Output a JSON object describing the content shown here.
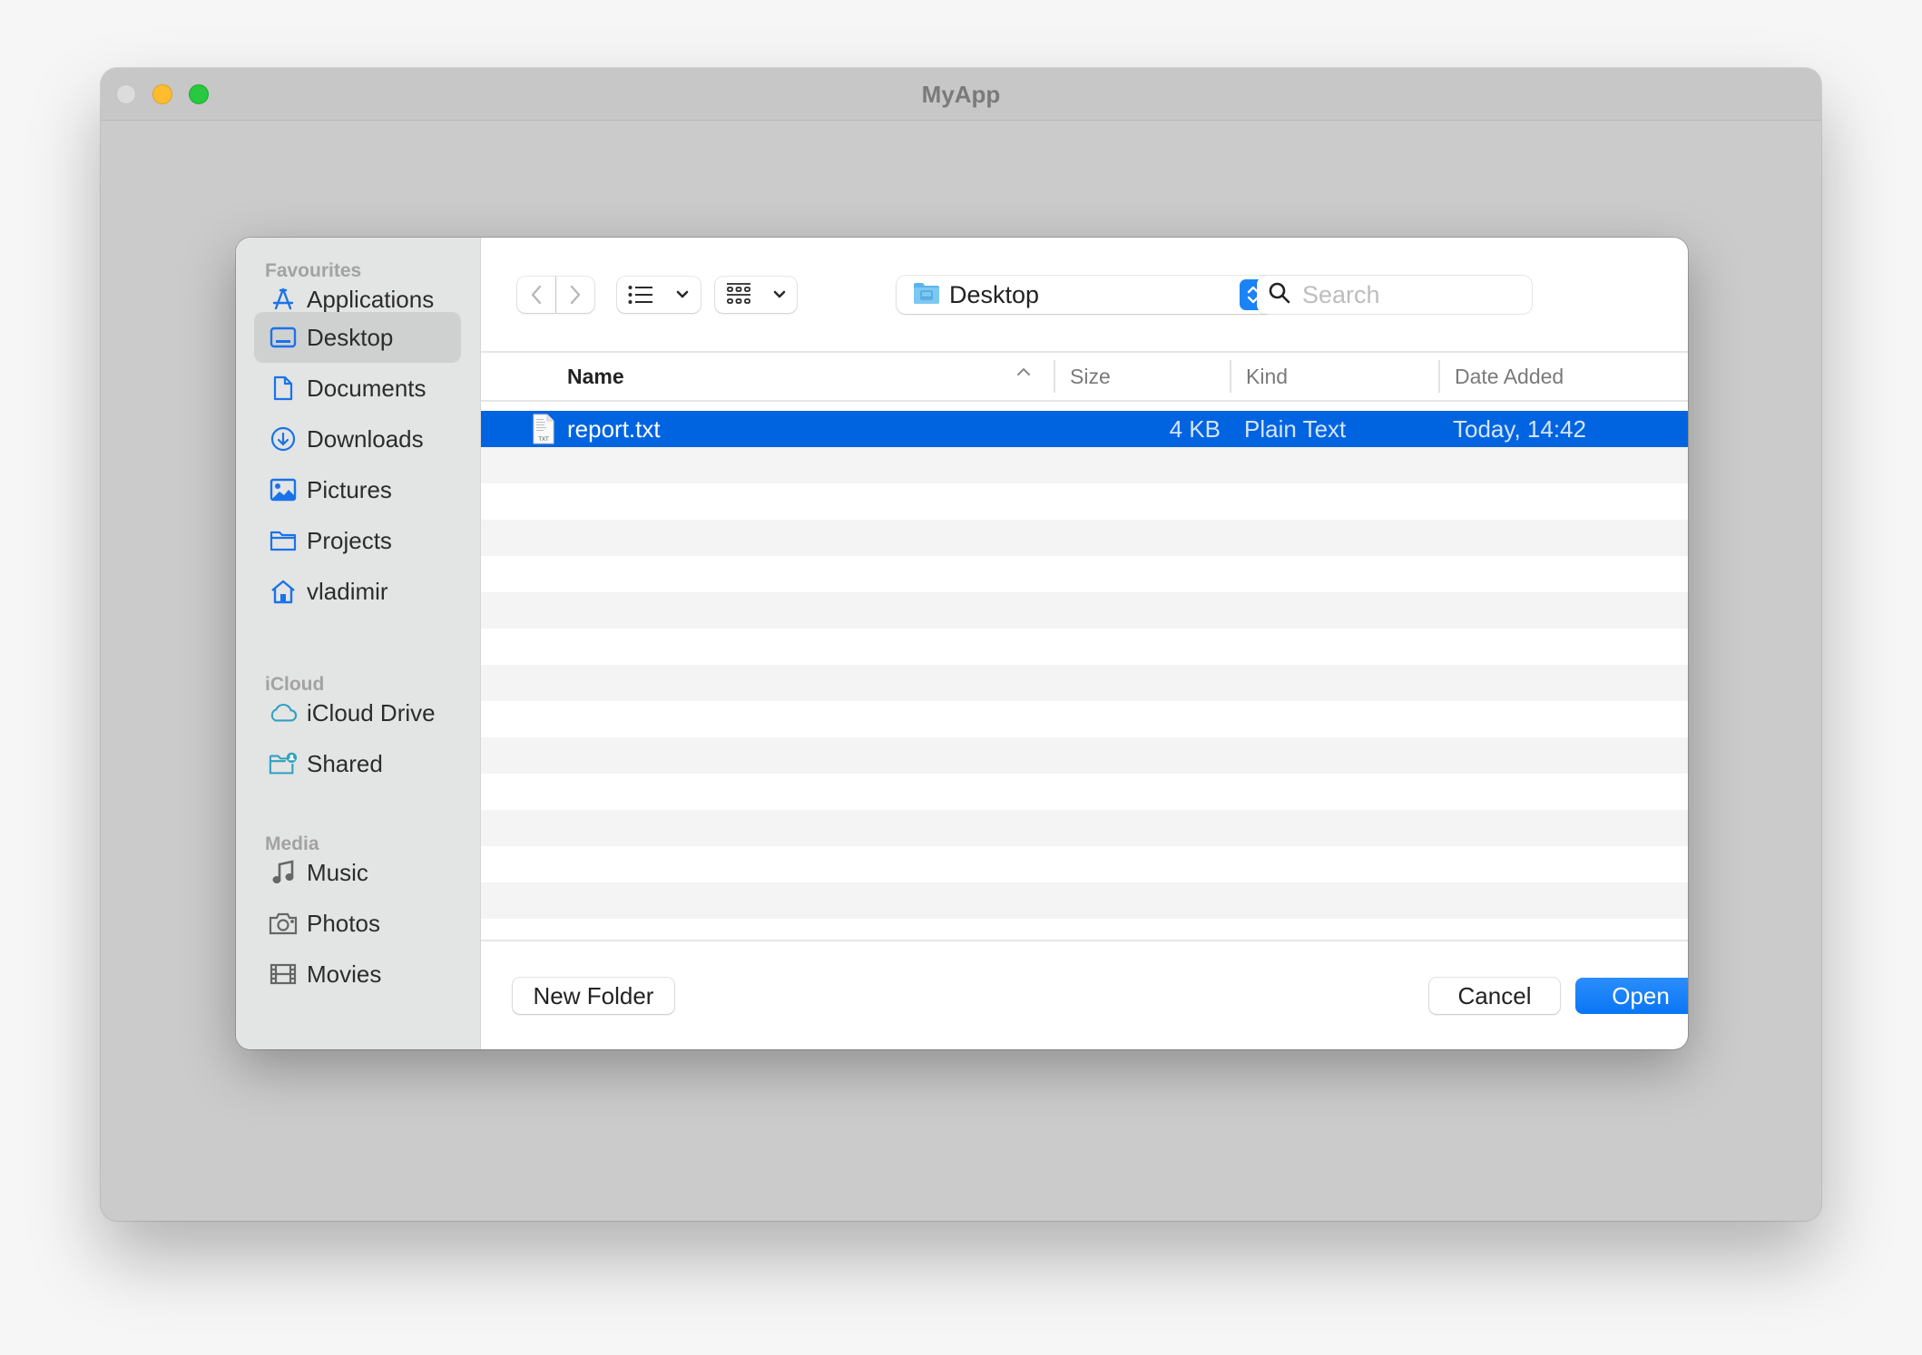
{
  "window": {
    "title": "MyApp",
    "traffic_lights": {
      "close_color": "#dcdcdc",
      "minimize_color": "#febc2e",
      "zoom_color": "#28c840"
    }
  },
  "dialog": {
    "sidebar": {
      "sections": [
        {
          "title": "Favourites",
          "items": [
            {
              "label": "Applications",
              "icon": "applications-icon",
              "active": false
            },
            {
              "label": "Desktop",
              "icon": "desktop-icon",
              "active": true
            },
            {
              "label": "Documents",
              "icon": "document-icon",
              "active": false
            },
            {
              "label": "Downloads",
              "icon": "download-icon",
              "active": false
            },
            {
              "label": "Pictures",
              "icon": "pictures-icon",
              "active": false
            },
            {
              "label": "Projects",
              "icon": "folder-icon",
              "active": false
            },
            {
              "label": "vladimir",
              "icon": "home-icon",
              "active": false
            }
          ]
        },
        {
          "title": "iCloud",
          "items": [
            {
              "label": "iCloud Drive",
              "icon": "cloud-icon",
              "active": false
            },
            {
              "label": "Shared",
              "icon": "shared-folder-icon",
              "active": false
            }
          ]
        },
        {
          "title": "Media",
          "items": [
            {
              "label": "Music",
              "icon": "music-note-icon",
              "active": false
            },
            {
              "label": "Photos",
              "icon": "camera-icon",
              "active": false
            },
            {
              "label": "Movies",
              "icon": "film-icon",
              "active": false
            }
          ]
        }
      ]
    },
    "toolbar": {
      "back_icon": "chevron-left-icon",
      "forward_icon": "chevron-right-icon",
      "list_view_icon": "list-view-icon",
      "grid_view_icon": "grid-view-icon",
      "location": "Desktop",
      "search_placeholder": "Search",
      "search_value": ""
    },
    "table": {
      "columns": [
        "Name",
        "Size",
        "Kind",
        "Date Added"
      ],
      "sort_column": "Name",
      "sort_direction": "ascending",
      "files": [
        {
          "name": "report.txt",
          "size": "4 KB",
          "kind": "Plain Text",
          "date_added": "Today, 14:42",
          "selected": true,
          "icon_label": "TXT"
        }
      ]
    },
    "footer": {
      "new_folder_label": "New Folder",
      "cancel_label": "Cancel",
      "open_label": "Open"
    },
    "colors": {
      "accent": "#0a76f5",
      "selection": "#0064e1",
      "sidebar_icon": "#1a73e8",
      "icloud_icon": "#2ea1c2",
      "media_icon": "#6b6b6b"
    }
  }
}
